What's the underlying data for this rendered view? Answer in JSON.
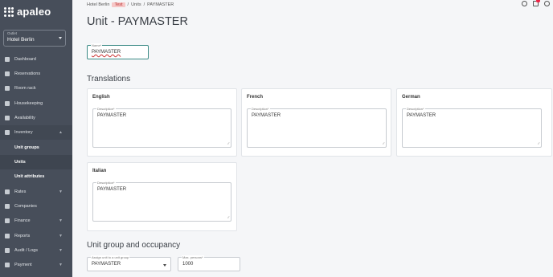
{
  "app": {
    "logo_text": "apaleo"
  },
  "outlet": {
    "label": "Outlet",
    "value": "Hotel Berlin"
  },
  "sidebar": {
    "items": [
      {
        "label": "Dashboard"
      },
      {
        "label": "Reservations"
      },
      {
        "label": "Room rack"
      },
      {
        "label": "Housekeeping"
      },
      {
        "label": "Availability"
      },
      {
        "label": "Inventory"
      },
      {
        "label": "Unit groups"
      },
      {
        "label": "Units"
      },
      {
        "label": "Unit attributes"
      },
      {
        "label": "Rates"
      },
      {
        "label": "Companies"
      },
      {
        "label": "Finance"
      },
      {
        "label": "Reports"
      },
      {
        "label": "Audit / Logs"
      },
      {
        "label": "Payment"
      }
    ]
  },
  "breadcrumb": {
    "items": [
      "Hotel Berlin",
      "Test",
      "/",
      "Units",
      "/",
      "PAYMASTER"
    ]
  },
  "page": {
    "title": "Unit - PAYMASTER"
  },
  "name_field": {
    "label": "Name*",
    "value": "PAYMASTER"
  },
  "translations": {
    "title": "Translations",
    "cards": [
      {
        "language": "English",
        "label": "Description*",
        "value": "PAYMASTER"
      },
      {
        "language": "French",
        "label": "Description*",
        "value": "PAYMASTER"
      },
      {
        "language": "German",
        "label": "Description*",
        "value": "PAYMASTER"
      },
      {
        "language": "Italian",
        "label": "Description*",
        "value": "PAYMASTER"
      }
    ]
  },
  "occupancy": {
    "title": "Unit group and occupancy",
    "unit_group": {
      "label": "Assign unit to a unit group",
      "value": "PAYMASTER"
    },
    "max_persons": {
      "label": "Max. persons*",
      "value": "1000"
    }
  },
  "icons": {
    "help": "help-icon",
    "notifications": "notifications-icon",
    "account": "account-icon"
  },
  "colors": {
    "sidebar": "#474e5a",
    "accent": "#3b8a85",
    "test_badge": "#f6c7c7"
  }
}
